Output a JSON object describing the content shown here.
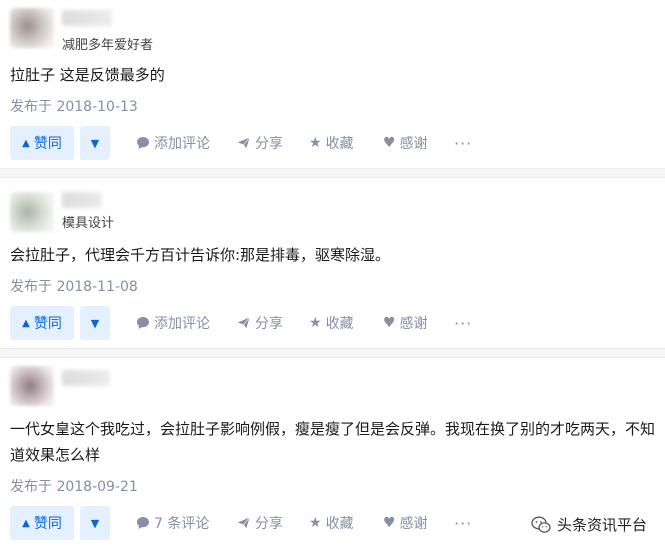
{
  "answers": [
    {
      "author_headline": "减肥多年爱好者",
      "content": "拉肚子 这是反馈最多的",
      "date": "发布于 2018-10-13",
      "comments": "添加评论"
    },
    {
      "author_headline": "模具设计",
      "content": "会拉肚子，代理会千方百计告诉你:那是排毒，驱寒除湿。",
      "date": "发布于 2018-11-08",
      "comments": "添加评论"
    },
    {
      "author_headline": "",
      "content": "一代女皇这个我吃过，会拉肚子影响例假，瘦是瘦了但是会反弹。我现在换了别的才吃两天，不知道效果怎么样",
      "date": "发布于 2018-09-21",
      "comments": "7 条评论"
    }
  ],
  "actions": {
    "vote_up": "赞同",
    "share": "分享",
    "collect": "收藏",
    "thanks": "感谢",
    "more": "···"
  },
  "icons": {
    "vote_up": "triangle-up-icon",
    "vote_down": "triangle-down-icon",
    "comment": "comment-bubble-icon",
    "share": "paper-plane-icon",
    "collect": "star-icon",
    "thanks": "heart-icon",
    "more": "ellipsis-icon",
    "watermark": "wechat-icon"
  },
  "watermark": "头条资讯平台",
  "colors": {
    "accent": "#0a66d8",
    "vote_bg": "#e5f0ff",
    "meta": "#8590a6"
  }
}
